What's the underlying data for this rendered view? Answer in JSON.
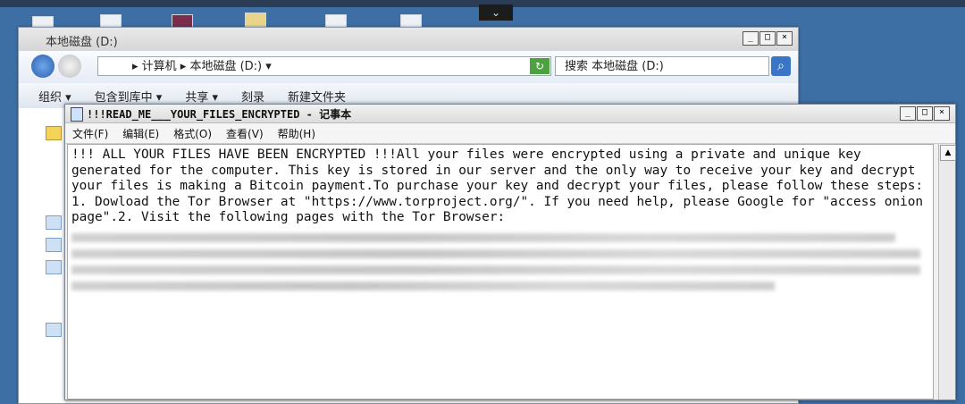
{
  "explorer": {
    "title": "本地磁盘 (D:)",
    "address": "▸ 计算机 ▸ 本地磁盘 (D:) ▾",
    "search_placeholder": "搜索 本地磁盘 (D:)",
    "toolbar": [
      "组织 ▾",
      "包含到库中 ▾",
      "共享 ▾",
      "刻录",
      "新建文件夹"
    ]
  },
  "notepad": {
    "title": "!!!READ_ME___YOUR_FILES_ENCRYPTED - 记事本",
    "menu": [
      "文件(F)",
      "编辑(E)",
      "格式(O)",
      "查看(V)",
      "帮助(H)"
    ],
    "text": "!!! ALL YOUR FILES HAVE BEEN ENCRYPTED !!!All your files were encrypted using a private and unique key generated for the computer. This key is stored in our server and the only way to receive your key and decrypt your files is making a Bitcoin payment.To purchase your key and decrypt your files, please follow these steps: 1. Dowload the Tor Browser at \"https://www.torproject.org/\". If you need help, please Google for \"access onion page\".2. Visit the following pages with the Tor Browser:"
  },
  "window_buttons": {
    "minimize": "_",
    "maximize": "□",
    "close": "×"
  },
  "colors": {
    "desktop": "#3d6fa5",
    "text_bg": "#ffffff"
  }
}
